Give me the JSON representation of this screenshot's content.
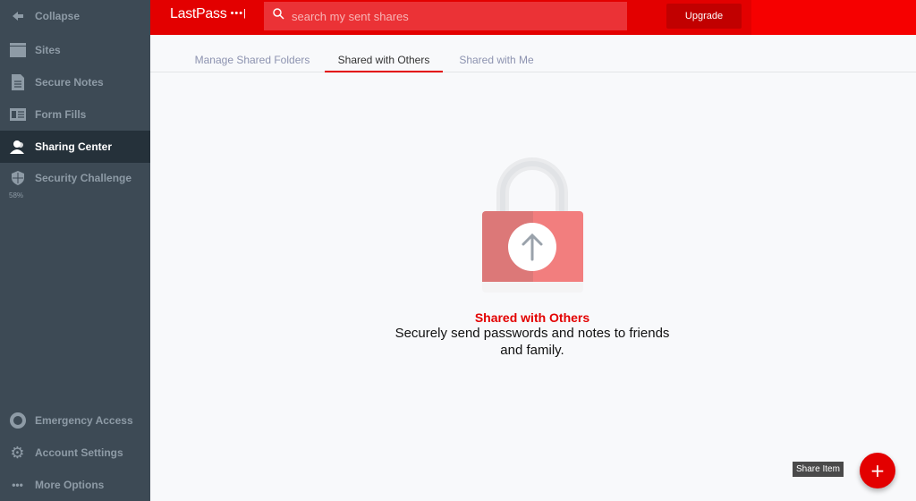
{
  "sidebar": {
    "items": [
      {
        "label": "Collapse",
        "icon": "arrow-left-icon"
      },
      {
        "label": "Sites",
        "icon": "browser-window-icon"
      },
      {
        "label": "Secure Notes",
        "icon": "note-icon"
      },
      {
        "label": "Form Fills",
        "icon": "id-card-icon"
      },
      {
        "label": "Sharing Center",
        "icon": "users-icon",
        "active": true
      },
      {
        "label": "Security Challenge",
        "icon": "shield-icon"
      },
      {
        "label": "Emergency Access",
        "icon": "life-ring-icon"
      },
      {
        "label": "Account Settings",
        "icon": "gear-icon"
      },
      {
        "label": "More Options",
        "icon": "ellipsis-icon"
      }
    ],
    "security_score": "58%"
  },
  "header": {
    "logo": "LastPass",
    "logo_dots": "•••|",
    "search_placeholder": "search my sent shares",
    "upgrade": "Upgrade"
  },
  "tabs": [
    {
      "label": "Manage Shared Folders"
    },
    {
      "label": "Shared with Others",
      "active": true
    },
    {
      "label": "Shared with Me"
    }
  ],
  "empty_state": {
    "title": "Shared with Others",
    "description": "Securely send passwords and notes to friends and family."
  },
  "fab": {
    "tooltip": "Share Item",
    "label": "+"
  },
  "colors": {
    "brand": "#e30000",
    "sidebar": "#3d4a55",
    "sidebar_active": "#25313a"
  }
}
